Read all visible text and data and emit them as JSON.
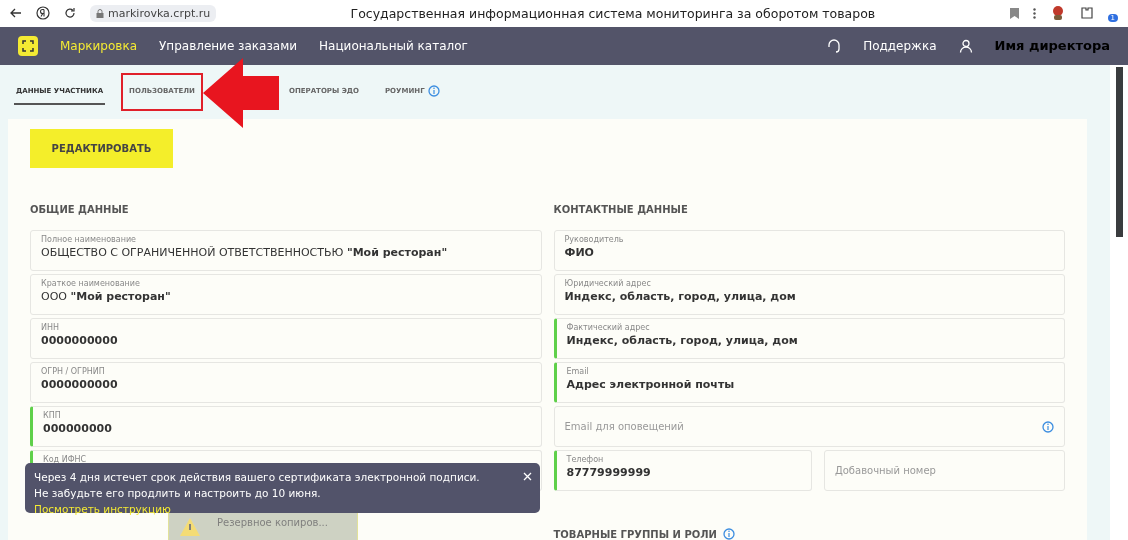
{
  "browser": {
    "url": "markirovka.crpt.ru",
    "title": "Государственная информационная система мониторинга за оборотом товаров",
    "badge": "1"
  },
  "header": {
    "nav": [
      {
        "label": "Маркировка",
        "selected": true
      },
      {
        "label": "Управление заказами",
        "selected": false
      },
      {
        "label": "Национальный каталог",
        "selected": false
      }
    ],
    "support": "Поддержка",
    "user": "Имя директора"
  },
  "tabs": [
    {
      "label": "ДАННЫЕ УЧАСТНИКА",
      "selected": true,
      "highlighted": false,
      "info": false
    },
    {
      "label": "ПОЛЬЗОВАТЕЛИ",
      "selected": false,
      "highlighted": true,
      "info": false
    },
    {
      "label": "ОПЕРАТОРЫ ЭДО",
      "selected": false,
      "highlighted": false,
      "info": false
    },
    {
      "label": "РОУМИНГ",
      "selected": false,
      "highlighted": false,
      "info": true
    }
  ],
  "edit_button": "РЕДАКТИРОВАТЬ",
  "general": {
    "title": "ОБЩИЕ ДАННЫЕ",
    "fields": [
      {
        "label": "Полное наименование",
        "value": "ОБЩЕСТВО С ОГРАНИЧЕННОЙ ОТВЕТСТВЕННОСТЬЮ **\"Мой ресторан\"**",
        "required": false
      },
      {
        "label": "Краткое наименование",
        "value": "ООО **\"Мой ресторан\"**",
        "required": false
      },
      {
        "label": "ИНН",
        "value": "**0000000000**",
        "required": false
      },
      {
        "label": "ОГРН / ОГРНИП",
        "value": "**0000000000**",
        "required": false
      },
      {
        "label": "КПП",
        "value": "**000000000**",
        "required": true
      },
      {
        "label": "Код ИФНС",
        "required": true
      }
    ]
  },
  "contacts": {
    "title": "КОНТАКТНЫЕ ДАННЫЕ",
    "fields": [
      {
        "kind": "filled",
        "label": "Руководитель",
        "value": "**ФИО**",
        "required": false
      },
      {
        "kind": "filled",
        "label": "Юридический адрес",
        "value": "**Индекс, область, город, улица, дом**",
        "required": false
      },
      {
        "kind": "filled",
        "label": "Фактический адрес",
        "value": "**Индекс, область, город, улица, дом**",
        "required": true
      },
      {
        "kind": "filled",
        "label": "Email",
        "value": "**Адрес электронной почты**",
        "required": true
      },
      {
        "kind": "empty",
        "placeholder": "Email для оповещений",
        "info": true,
        "required": false
      },
      {
        "kind": "pair",
        "label": "Телефон",
        "value": "**87779999999**",
        "required": true,
        "extra_placeholder": "Добавочный номер"
      }
    ]
  },
  "groups_title": "ТОВАРНЫЕ ГРУППЫ И РОЛИ",
  "toast": {
    "lines": [
      "Через 4 дня истечет срок действия вашего сертификата электронной подписи.",
      "Не забудьте его продлить и настроить до 10 июня."
    ],
    "link": "Посмотреть инструкцию"
  },
  "backup_popup": {
    "title": "Резервное копиров..."
  }
}
